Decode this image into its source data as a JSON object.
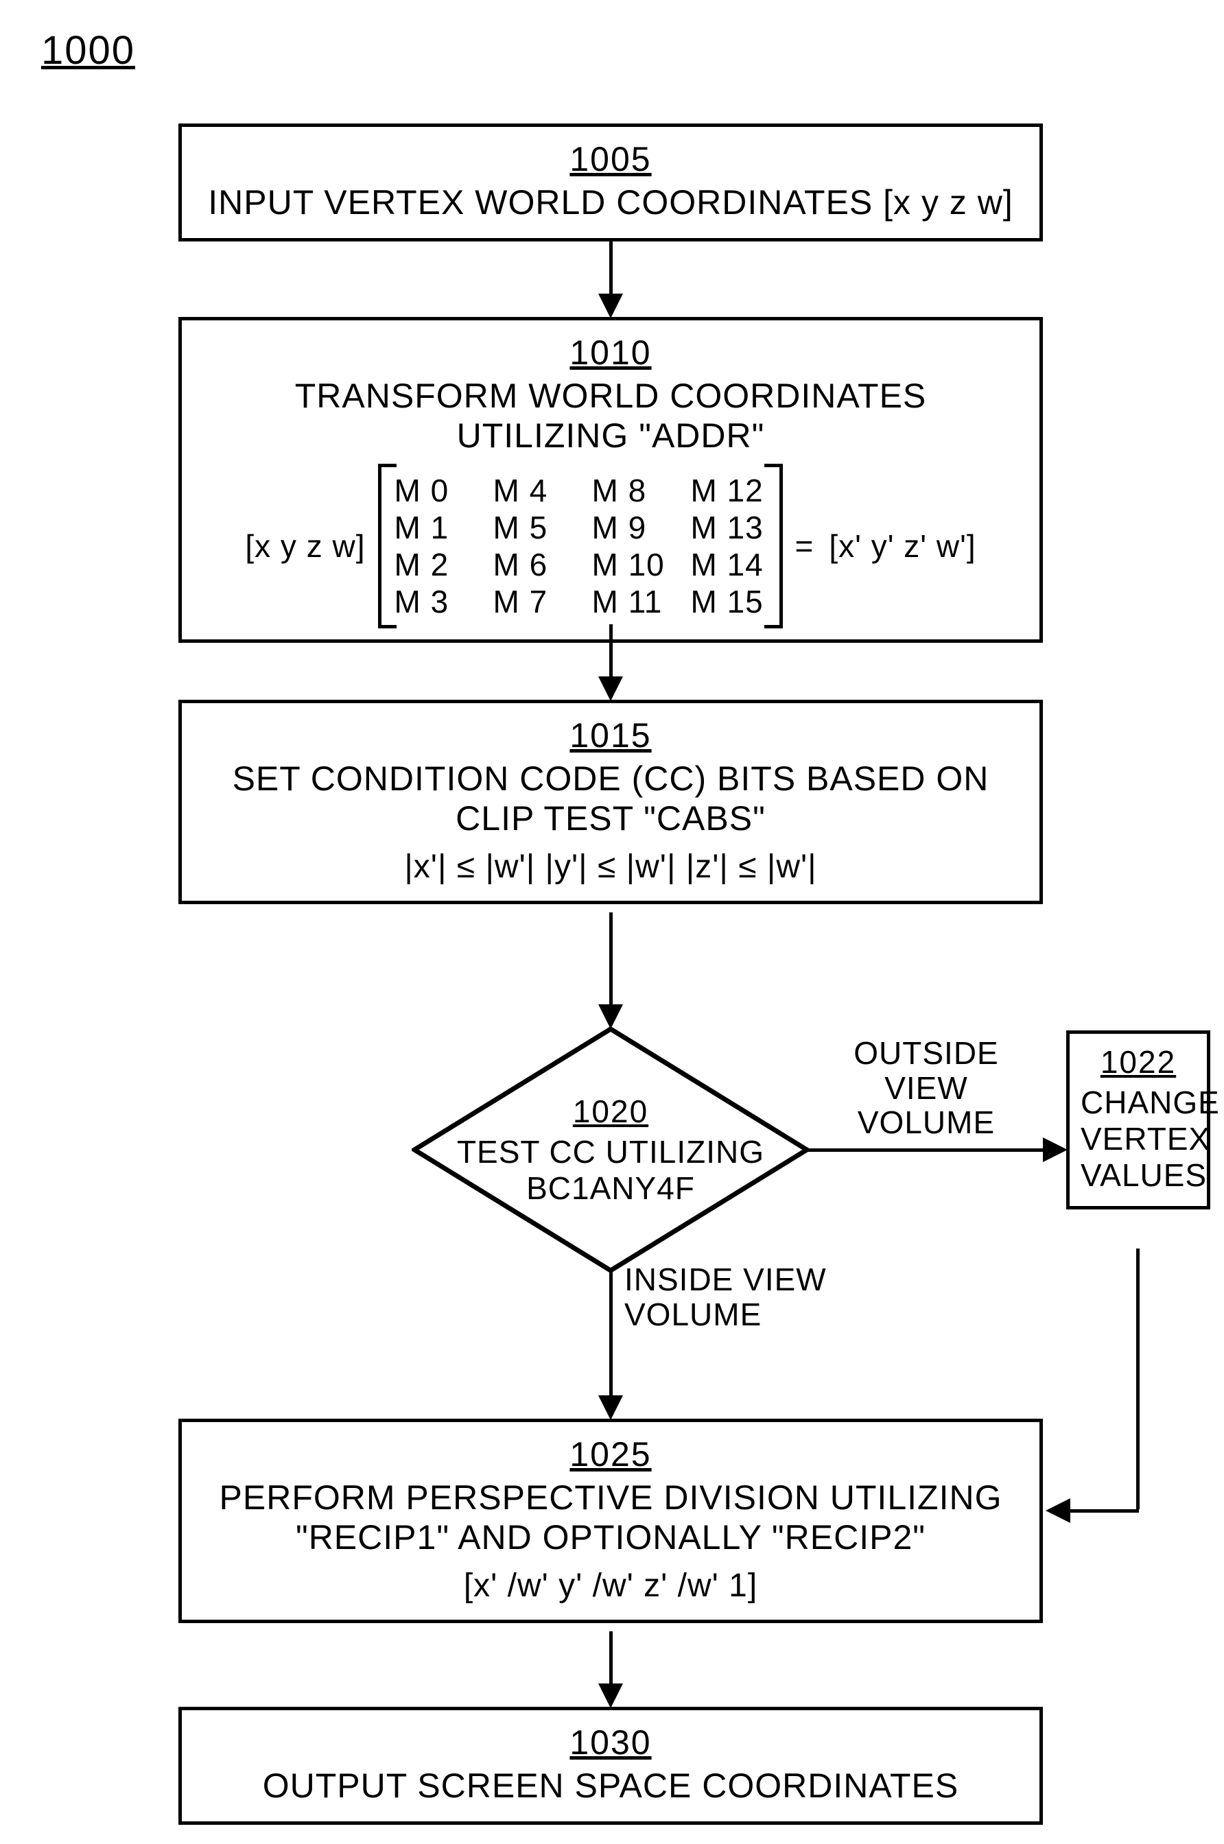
{
  "figure_label": "1000",
  "nodes": {
    "n1005": {
      "num": "1005",
      "text": "INPUT VERTEX WORLD COORDINATES [x  y  z  w]"
    },
    "n1010": {
      "num": "1010",
      "line1": "TRANSFORM WORLD COORDINATES",
      "line2": "UTILIZING \"ADDR\"",
      "lhs": "[x  y  z  w]",
      "matrix": {
        "r0": [
          "M 0",
          "M 4",
          "M 8",
          "M 12"
        ],
        "r1": [
          "M 1",
          "M 5",
          "M 9",
          "M 13"
        ],
        "r2": [
          "M 2",
          "M 6",
          "M 10",
          "M 14"
        ],
        "r3": [
          "M 3",
          "M 7",
          "M 11",
          "M 15"
        ]
      },
      "eq": "=",
      "rhs": "[x' y' z' w']"
    },
    "n1015": {
      "num": "1015",
      "line1": "SET CONDITION CODE (CC) BITS BASED ON",
      "line2": "CLIP TEST \"CABS\"",
      "expr": "|x'| ≤ |w'|      |y'| ≤ |w'|     |z'| ≤ |w'|"
    },
    "n1020": {
      "num": "1020",
      "line1": "TEST CC UTILIZING",
      "line2": "BC1ANY4F"
    },
    "n1022": {
      "num": "1022",
      "line1": "CHANGE",
      "line2": "VERTEX",
      "line3": "VALUES"
    },
    "n1025": {
      "num": "1025",
      "line1": "PERFORM PERSPECTIVE DIVISION UTILIZING",
      "line2": "\"RECIP1\" AND OPTIONALLY \"RECIP2\"",
      "expr": "[x' /w'      y' /w'      z' /w'      1]"
    },
    "n1030": {
      "num": "1030",
      "text": "OUTPUT SCREEN SPACE COORDINATES"
    }
  },
  "labels": {
    "outside": "OUTSIDE\nVIEW VOLUME",
    "inside": "INSIDE VIEW\nVOLUME"
  }
}
